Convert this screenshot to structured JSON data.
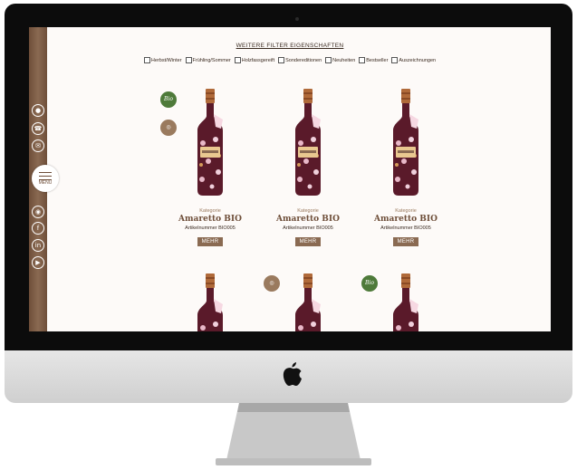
{
  "filters": {
    "title": "WEITERE FILTER EIGENSCHAFTEN",
    "options": [
      "Herbst/Winter",
      "Frühling/Sommer",
      "Holzfassgereift",
      "Sondereditionen",
      "Neuheiten",
      "Bestseller",
      "Auszeichnungen"
    ]
  },
  "sidebar": {
    "menu_label": "MENU"
  },
  "products": [
    {
      "category": "Kategorie",
      "name": "Amaretto BIO",
      "article": "Artikelnummer BIO005",
      "button": "MEHR"
    },
    {
      "category": "Kategorie",
      "name": "Amaretto BIO",
      "article": "Artikelnummer BIO005",
      "button": "MEHR"
    },
    {
      "category": "Kategorie",
      "name": "Amaretto BIO",
      "article": "Artikelnummer BIO005",
      "button": "MEHR"
    }
  ],
  "badges": {
    "bio_label": "Bio"
  },
  "colors": {
    "brand_brown": "#8a6a52",
    "bio_green": "#4e7a3a",
    "bottle_wine": "#5a1a2a",
    "cap_copper": "#b06a3a"
  }
}
